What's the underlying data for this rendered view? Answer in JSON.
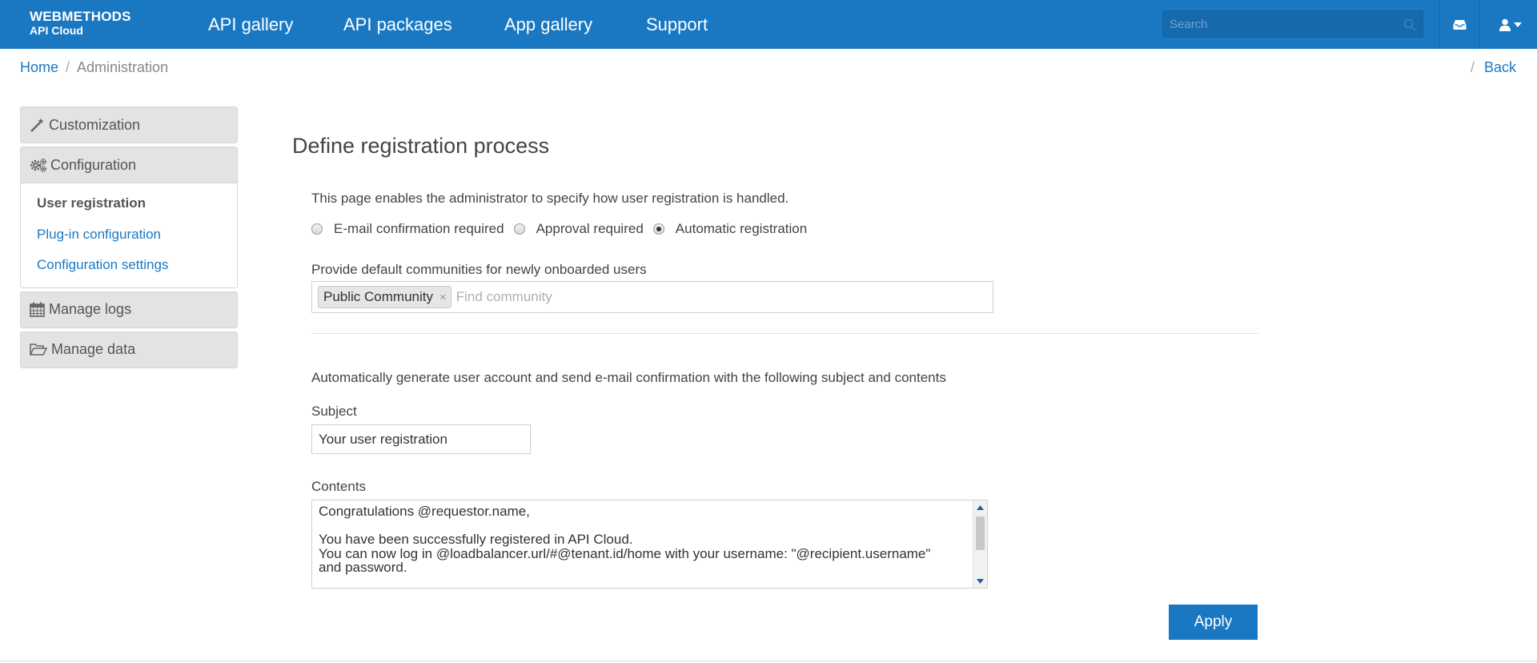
{
  "brand": {
    "line1": "WEBMETHODS",
    "line2": "API Cloud"
  },
  "nav": [
    {
      "label": "API gallery"
    },
    {
      "label": "API packages"
    },
    {
      "label": "App gallery"
    },
    {
      "label": "Support"
    }
  ],
  "search": {
    "placeholder": "Search"
  },
  "breadcrumb": {
    "home": "Home",
    "separator": "/",
    "current": "Administration"
  },
  "back": {
    "separator": "/",
    "label": "Back"
  },
  "sidebar": {
    "customization": "Customization",
    "configuration": {
      "label": "Configuration",
      "items": [
        {
          "label": "User registration"
        },
        {
          "label": "Plug-in configuration"
        },
        {
          "label": "Configuration settings"
        }
      ]
    },
    "manage_logs": "Manage logs",
    "manage_data": "Manage data"
  },
  "main": {
    "title": "Define registration process",
    "description": "This page enables the administrator to specify how user registration is handled.",
    "radios": [
      {
        "label": "E-mail confirmation required",
        "selected": false
      },
      {
        "label": "Approval required",
        "selected": false
      },
      {
        "label": "Automatic registration",
        "selected": true
      }
    ],
    "communities": {
      "label": "Provide default communities for newly onboarded users",
      "chips": [
        "Public Community"
      ],
      "chip_remove": "×",
      "placeholder": "Find community"
    },
    "auto_text": "Automatically generate user account and send e-mail confirmation with the following subject and contents",
    "subject": {
      "label": "Subject",
      "value": "Your user registration"
    },
    "contents": {
      "label": "Contents",
      "value": "Congratulations @requestor.name,\n\nYou have been successfully registered in API Cloud.\nYou can now log in @loadbalancer.url/#@tenant.id/home with your username: \"@recipient.username\"\nand password.\n\nBest Regards,"
    },
    "apply_label": "Apply"
  },
  "colors": {
    "primary": "#1a78c2",
    "sidebar_bg": "#e3e3e3"
  }
}
